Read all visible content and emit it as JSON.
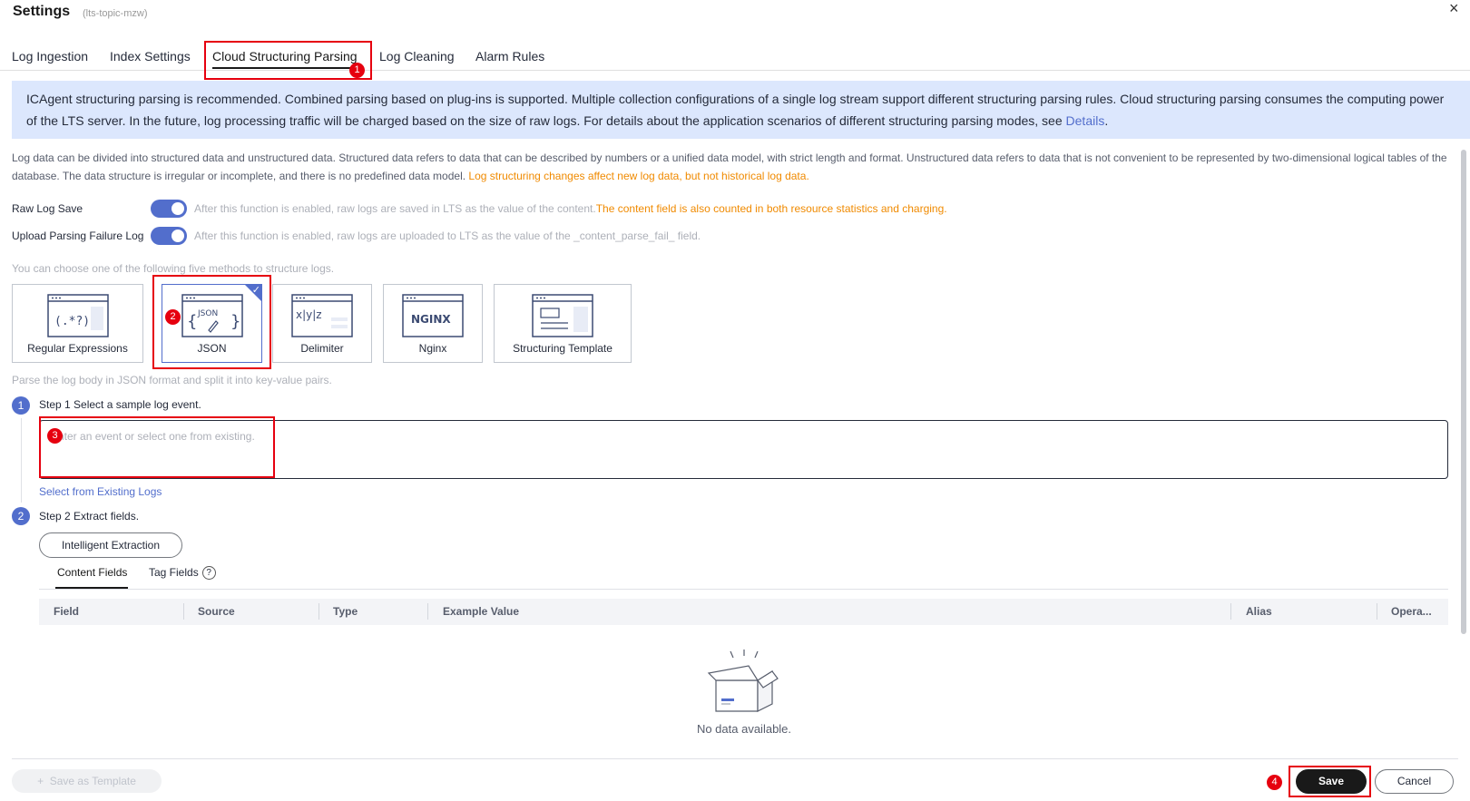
{
  "header": {
    "title": "Settings",
    "subtitle": "(lts-topic-mzw)",
    "close_glyph": "×"
  },
  "tabs": [
    {
      "label": "Log Ingestion"
    },
    {
      "label": "Index Settings"
    },
    {
      "label": "Cloud Structuring Parsing",
      "active": true
    },
    {
      "label": "Log Cleaning"
    },
    {
      "label": "Alarm Rules"
    }
  ],
  "annotations": [
    "1",
    "2",
    "3",
    "4"
  ],
  "info_banner": {
    "text": "ICAgent structuring parsing is recommended. Combined parsing based on plug-ins is supported. Multiple collection configurations of a single log stream support different structuring parsing rules. Cloud structuring parsing consumes the computing power of the LTS server. In the future, log processing traffic will be charged based on the size of raw logs. For details about the application scenarios of different structuring parsing modes, see",
    "link": "Details",
    "tail": "."
  },
  "description": {
    "text": "Log data can be divided into structured data and unstructured data. Structured data refers to data that can be described by numbers or a unified data model, with strict length and format. Unstructured data refers to data that is not convenient to be represented by two-dimensional logical tables of the database. The data structure is irregular or incomplete, and there is no predefined data model.",
    "warning": "Log structuring changes affect new log data, but not historical log data."
  },
  "raw_log_save": {
    "label": "Raw Log Save",
    "hint": "After this function is enabled, raw logs are saved in LTS as the value of the content.",
    "warning": "The content field is also counted in both resource statistics and charging."
  },
  "upload_failure": {
    "label": "Upload Parsing Failure Log",
    "hint": "After this function is enabled, raw logs are uploaded to LTS as the value of the _content_parse_fail_ field."
  },
  "methods": {
    "intro": "You can choose one of the following five methods to structure logs.",
    "items": [
      {
        "label": "Regular Expressions",
        "icon_text": "(.*?)"
      },
      {
        "label": "JSON",
        "icon_text": "JSON",
        "selected": true
      },
      {
        "label": "Delimiter",
        "icon_text": "x|y|z"
      },
      {
        "label": "Nginx",
        "icon_text": "NGINX"
      },
      {
        "label": "Structuring Template",
        "icon_text": ""
      }
    ],
    "selected_desc": "Parse the log body in JSON format and split it into key-value pairs."
  },
  "step1": {
    "num": "1",
    "title": "Step 1 Select a sample log event.",
    "placeholder": "Enter an event or select one from existing.",
    "link": "Select from Existing Logs"
  },
  "step2": {
    "num": "2",
    "title": "Step 2 Extract fields.",
    "button": "Intelligent Extraction",
    "subtabs": [
      "Content Fields",
      "Tag Fields"
    ],
    "tag_help": "?",
    "columns": [
      "Field",
      "Source",
      "Type",
      "Example Value",
      "Alias",
      "Opera..."
    ],
    "empty": "No data available."
  },
  "footer": {
    "template_button": "Save as Template",
    "save": "Save",
    "cancel": "Cancel"
  }
}
